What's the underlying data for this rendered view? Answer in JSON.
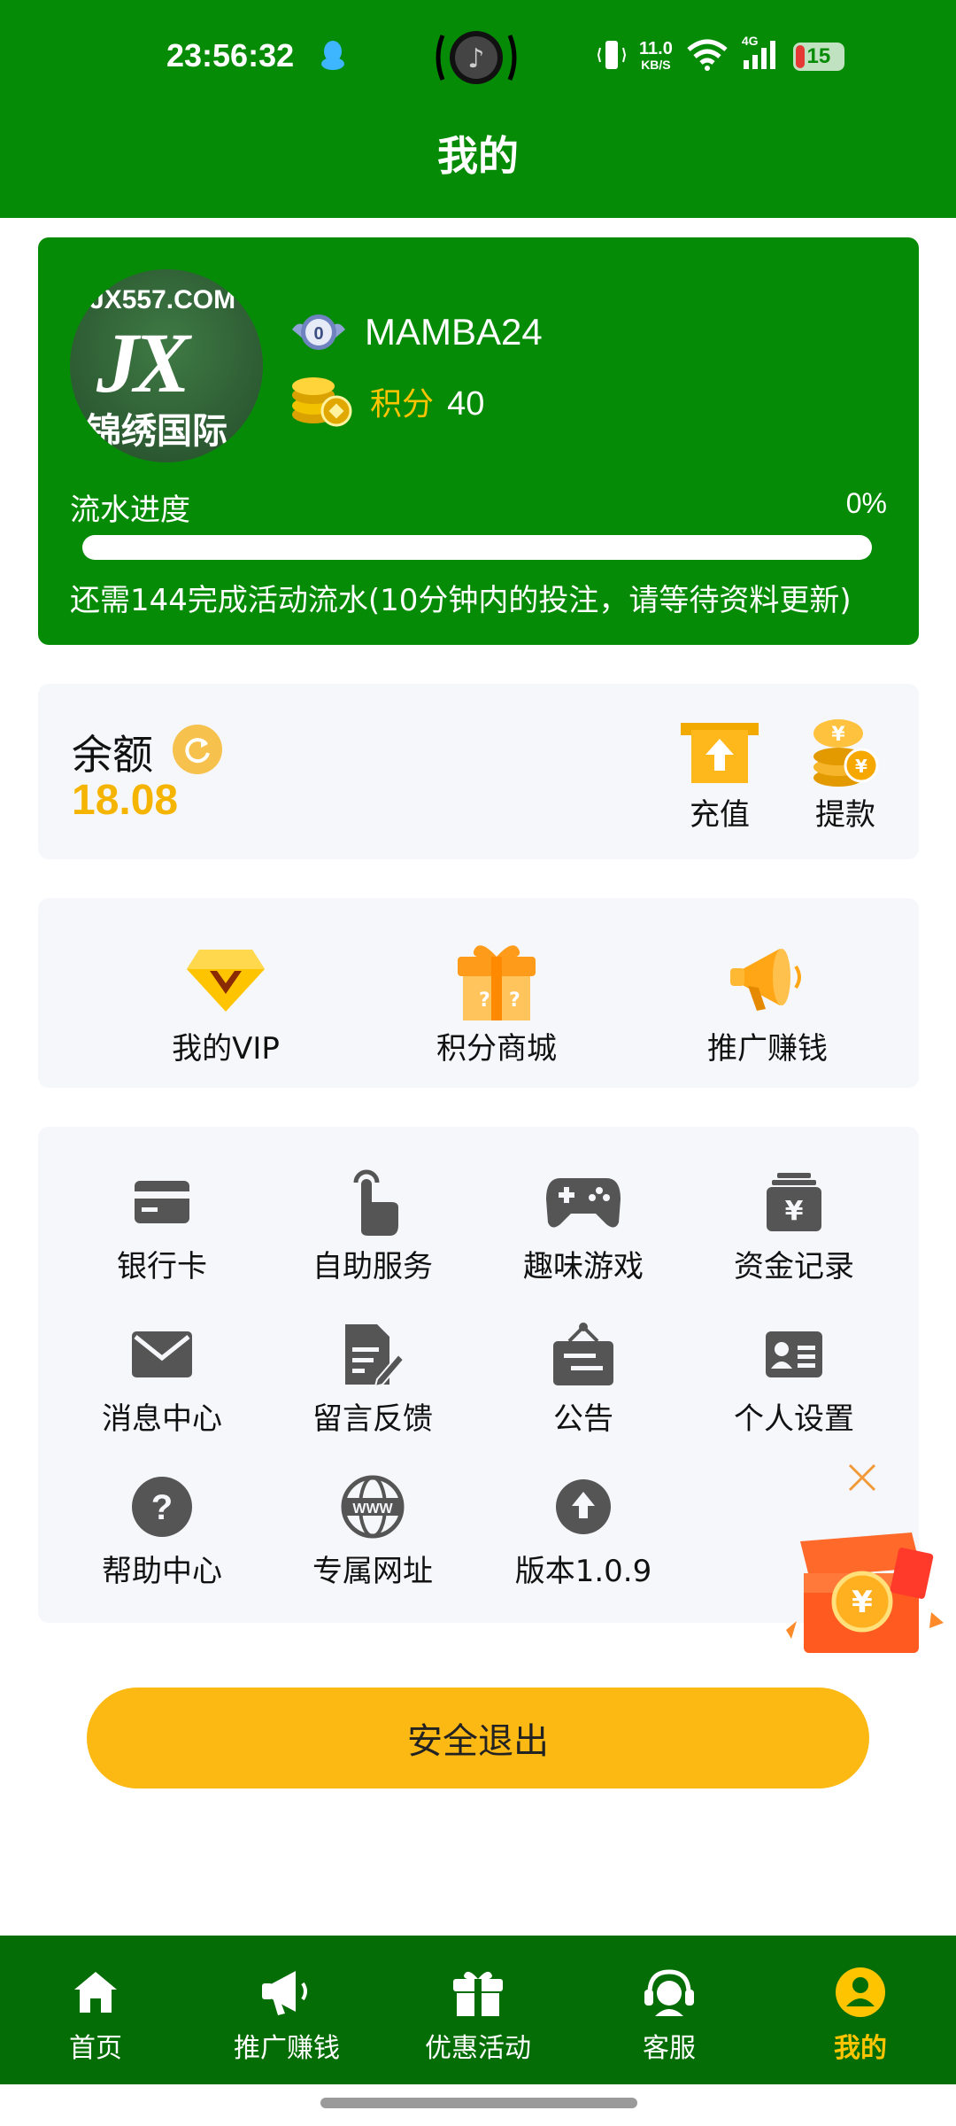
{
  "status_bar": {
    "time": "23:56:32",
    "net_speed_value": "11.0",
    "net_speed_unit": "KB/S",
    "network": "4G",
    "battery": "15",
    "icons": [
      "qq-icon",
      "music-icon",
      "vibrate-icon",
      "wifi-icon",
      "signal-icon",
      "battery-icon"
    ]
  },
  "header": {
    "title": "我的"
  },
  "profile": {
    "avatar_text_top": "JX557.COM",
    "avatar_text_mid": "JX",
    "avatar_text_bottom": "锦绣国际",
    "level": "0",
    "username": "MAMBA24",
    "points_label": "积分",
    "points_value": "40",
    "progress_label": "流水进度",
    "progress_percent_text": "0%",
    "progress_fraction": 0,
    "progress_note": "还需144完成活动流水(10分钟内的投注，请等待资料更新)"
  },
  "balance": {
    "label": "余额",
    "value": "18.08",
    "recharge_label": "充值",
    "withdraw_label": "提款"
  },
  "features": [
    {
      "label": "我的VIP",
      "icon": "vip-diamond-icon"
    },
    {
      "label": "积分商城",
      "icon": "gift-box-icon"
    },
    {
      "label": "推广赚钱",
      "icon": "megaphone-icon"
    }
  ],
  "grid": [
    {
      "label": "银行卡",
      "icon": "bank-card-icon"
    },
    {
      "label": "自助服务",
      "icon": "hand-tap-icon"
    },
    {
      "label": "趣味游戏",
      "icon": "gamepad-icon"
    },
    {
      "label": "资金记录",
      "icon": "money-record-icon"
    },
    {
      "label": "消息中心",
      "icon": "mail-icon"
    },
    {
      "label": "留言反馈",
      "icon": "feedback-icon"
    },
    {
      "label": "公告",
      "icon": "notice-board-icon"
    },
    {
      "label": "个人设置",
      "icon": "id-card-icon"
    },
    {
      "label": "帮助中心",
      "icon": "help-icon"
    },
    {
      "label": "专属网址",
      "icon": "www-icon"
    },
    {
      "label": "版本1.0.9",
      "icon": "upload-icon"
    }
  ],
  "logout_label": "安全退出",
  "bottom_nav": [
    {
      "label": "首页",
      "icon": "home-icon"
    },
    {
      "label": "推广赚钱",
      "icon": "megaphone-icon"
    },
    {
      "label": "优惠活动",
      "icon": "gift-icon"
    },
    {
      "label": "客服",
      "icon": "headset-icon"
    },
    {
      "label": "我的",
      "icon": "user-icon",
      "active": true
    }
  ],
  "colors": {
    "brand_green": "#068b06",
    "nav_green": "#056d05",
    "accent_yellow": "#fdb913",
    "points_yellow": "#ffc400",
    "icon_grey": "#555555"
  }
}
